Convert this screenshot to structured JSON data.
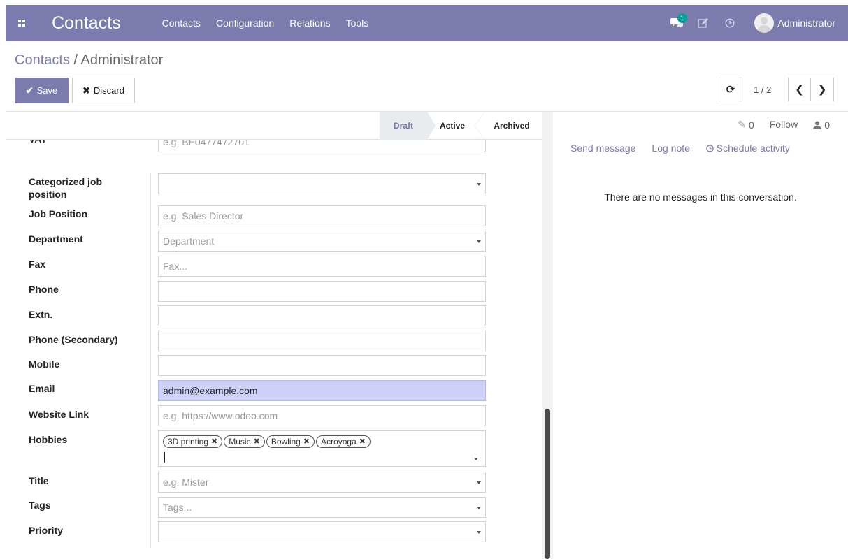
{
  "navbar": {
    "brand": "Contacts",
    "menu": [
      "Contacts",
      "Configuration",
      "Relations",
      "Tools"
    ],
    "message_count": "1",
    "user_name": "Administrator"
  },
  "control_panel": {
    "breadcrumb_parent": "Contacts",
    "breadcrumb_sep": " / ",
    "breadcrumb_current": "Administrator",
    "save_label": "Save",
    "discard_label": "Discard",
    "pager_value": "1 / 2"
  },
  "statusbar": {
    "stages": [
      "Draft",
      "Active",
      "Archived"
    ],
    "current": "Draft"
  },
  "form": {
    "vat_label": "VAT",
    "vat_placeholder": "e.g. BE0477472701",
    "categorized_job_label": "Categorized job position",
    "job_position_label": "Job Position",
    "job_position_placeholder": "e.g. Sales Director",
    "department_label": "Department",
    "department_placeholder": "Department",
    "fax_label": "Fax",
    "fax_placeholder": "Fax...",
    "phone_label": "Phone",
    "extn_label": "Extn.",
    "phone_secondary_label": "Phone (Secondary)",
    "mobile_label": "Mobile",
    "email_label": "Email",
    "email_value": "admin@example.com",
    "website_label": "Website Link",
    "website_placeholder": "e.g. https://www.odoo.com",
    "hobbies_label": "Hobbies",
    "hobbies": [
      "3D printing",
      "Music",
      "Bowling",
      "Acroyoga"
    ],
    "title_label": "Title",
    "title_placeholder": "e.g. Mister",
    "tags_label": "Tags",
    "tags_placeholder": "Tags...",
    "priority_label": "Priority"
  },
  "chatter": {
    "attachments_count": "0",
    "follow_label": "Follow",
    "followers_count": "0",
    "send_message": "Send message",
    "log_note": "Log note",
    "schedule_activity": "Schedule activity",
    "empty_text": "There are no messages in this conversation."
  },
  "colors": {
    "brand": "#7c7bad",
    "badge": "#00a09d",
    "email_highlight": "#cfd0f7"
  }
}
